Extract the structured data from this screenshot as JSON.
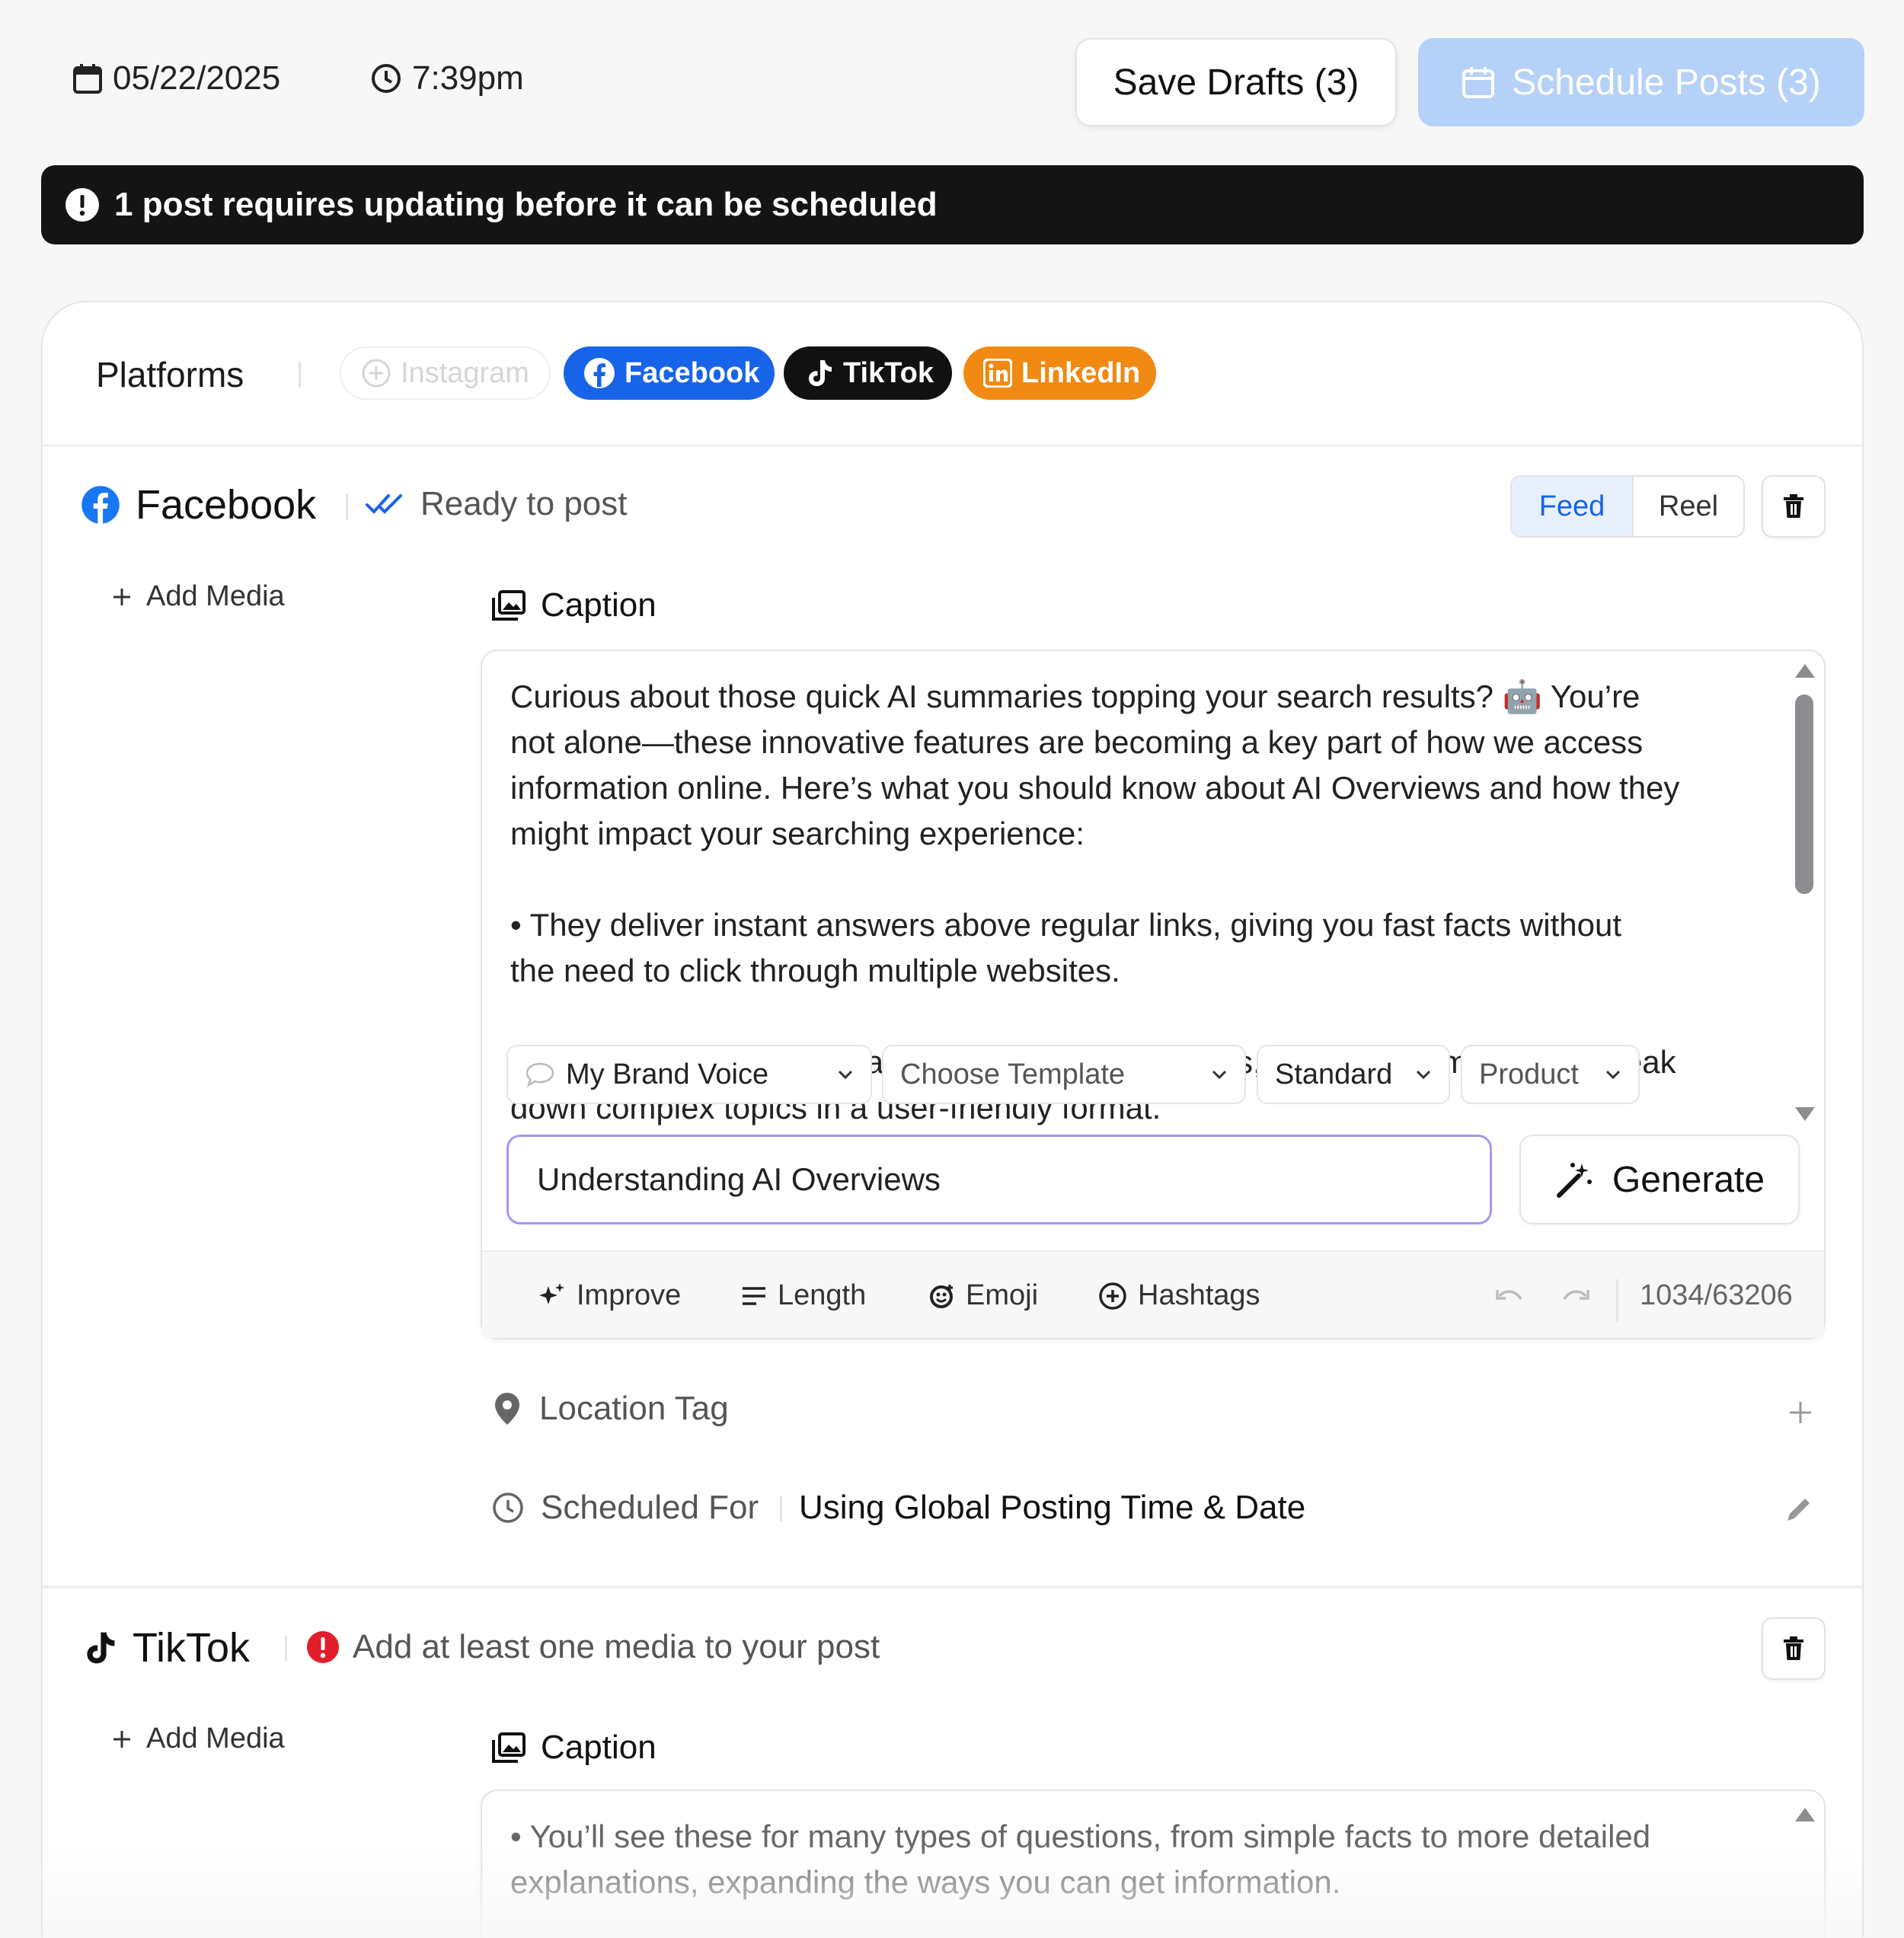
{
  "topbar": {
    "date": "05/22/2025",
    "time": "7:39pm",
    "save_drafts_label": "Save Drafts (3)",
    "schedule_posts_label": "Schedule Posts (3)"
  },
  "alert": {
    "text": "1 post requires updating before it can be scheduled"
  },
  "platforms": {
    "label": "Platforms",
    "chips": [
      {
        "label": "Instagram",
        "selected": false,
        "color": "#d6d6d8"
      },
      {
        "label": "Facebook",
        "selected": true,
        "color": "#1764e8"
      },
      {
        "label": "TikTok",
        "selected": true,
        "color": "#111111"
      },
      {
        "label": "LinkedIn",
        "selected": true,
        "color": "#f08a12"
      }
    ]
  },
  "facebook": {
    "title": "Facebook",
    "status": "Ready to post",
    "post_types": [
      "Feed",
      "Reel"
    ],
    "selected_post_type": "Feed",
    "add_media_label": "Add Media",
    "caption_label": "Caption",
    "caption_text": "Curious about those quick AI summaries topping your search results? 🤖 You’re\nnot alone—these innovative features are becoming a key part of how we access\ninformation online. Here’s what you should know about AI Overviews and how they\nmight impact your searching experience:\n\n• They deliver instant answers above regular links, giving you fast facts without\nthe need to click through multiple websites.\n\n• The AI combines information from different sources, helping to simplify and break\ndown complex topics in a user-friendly format.",
    "dropdowns": [
      "My Brand Voice",
      "Choose Template",
      "Standard",
      "Product"
    ],
    "topic_value": "Understanding AI Overviews",
    "generate_label": "Generate",
    "tools": [
      "Improve",
      "Length",
      "Emoji",
      "Hashtags"
    ],
    "char_count": "1034/63206",
    "location_label": "Location Tag",
    "scheduled_label": "Scheduled For",
    "scheduled_value": "Using Global Posting Time & Date"
  },
  "tiktok": {
    "title": "TikTok",
    "status": "Add at least one media to your post",
    "add_media_label": "Add Media",
    "caption_label": "Caption",
    "caption_text": "• You’ll see these for many types of questions, from simple facts to more detailed\nexplanations, expanding the ways you can get information."
  },
  "colors": {
    "accent": "#1764e8",
    "schedule_disabled": "#b5d1f7",
    "alert_bg": "#141414",
    "error": "#e11d2a",
    "topic_border": "#a996ef"
  }
}
